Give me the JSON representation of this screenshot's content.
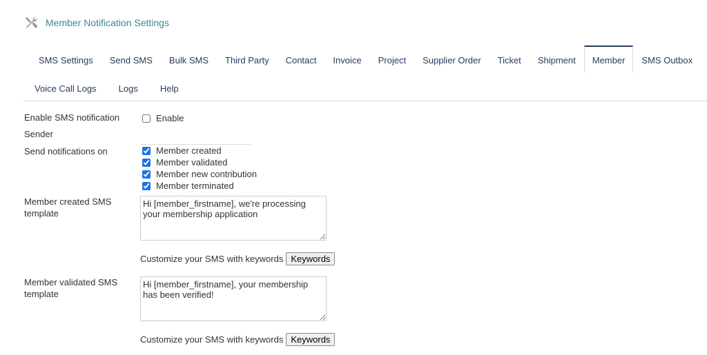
{
  "header": {
    "title": "Member Notification Settings",
    "icon": "tools-icon"
  },
  "tabs": [
    "SMS Settings",
    "Send SMS",
    "Bulk SMS",
    "Third Party",
    "Contact",
    "Invoice",
    "Project",
    "Supplier Order",
    "Ticket",
    "Shipment",
    "Member",
    "SMS Outbox"
  ],
  "tabs_row2": [
    "Voice Call Logs",
    "Logs",
    "Help"
  ],
  "active_tab": "Member",
  "form": {
    "enable_label": "Enable SMS notification",
    "enable_option": "Enable",
    "enable_checked": false,
    "sender_label": "Sender",
    "sender_value": "",
    "notify_label": "Send notifications on",
    "notify_options": [
      {
        "label": "Member created",
        "checked": true
      },
      {
        "label": "Member validated",
        "checked": true
      },
      {
        "label": "Member new contribution",
        "checked": true
      },
      {
        "label": "Member terminated",
        "checked": true
      }
    ],
    "created_label": "Member created SMS template",
    "created_template": "Hi [member_firstname], we're processing your membership application",
    "validated_label": "Member validated SMS template",
    "validated_template": "Hi [member_firstname], your membership has been verified!",
    "customize_text": "Customize your SMS with keywords",
    "keywords_button": "Keywords"
  }
}
